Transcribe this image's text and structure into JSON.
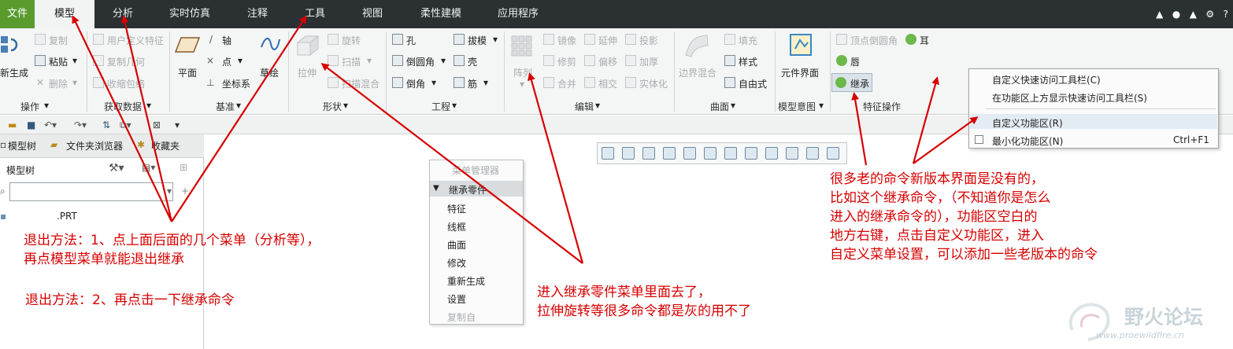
{
  "tabs": [
    {
      "label": "文件"
    },
    {
      "label": "模型"
    },
    {
      "label": "分析"
    },
    {
      "label": "实时仿真"
    },
    {
      "label": "注释"
    },
    {
      "label": "工具"
    },
    {
      "label": "视图"
    },
    {
      "label": "柔性建模"
    },
    {
      "label": "应用程序"
    }
  ],
  "ribbon": {
    "operations": {
      "regen_label": "新生成",
      "copy": "复制",
      "paste": "粘贴",
      "delete": "删除",
      "group_label": "操作"
    },
    "get_data": {
      "udf": "用户定义特征",
      "copy_geom": "复制几何",
      "shrinkwrap": "收缩包络",
      "group_label": "获取数据"
    },
    "datum": {
      "plane": "平面",
      "axis": "轴",
      "point": "点",
      "csys": "坐标系",
      "sketch": "草绘",
      "group_label": "基准"
    },
    "shapes": {
      "extrude": "拉伸",
      "revolve": "旋转",
      "sweep": "扫描",
      "swept_blend": "扫描混合",
      "group_label": "形状"
    },
    "engineering": {
      "hole": "孔",
      "round": "倒圆角",
      "chamfer": "倒角",
      "draft": "拔模",
      "shell": "壳",
      "rib": "筋",
      "group_label": "工程"
    },
    "editing": {
      "pattern": "阵列",
      "mirror": "镜像",
      "trim": "修剪",
      "merge": "合并",
      "extend": "延伸",
      "offset": "偏移",
      "intersect": "相交",
      "project": "投影",
      "thicken": "加厚",
      "solidify": "实体化",
      "group_label": "编辑"
    },
    "surfaces": {
      "boundary_blend": "边界混合",
      "fill": "填充",
      "style": "样式",
      "freestyle": "自由式",
      "group_label": "曲面"
    },
    "model_intent": {
      "component_interface": "元件界面",
      "group_label": "模型意图"
    },
    "feature_ops": {
      "vertex_round": "顶点倒圆角",
      "ear": "耳",
      "lip": "唇",
      "inheritance": "继承",
      "group_label": "特征操作"
    }
  },
  "left_panel": {
    "tab_model_tree": "模型树",
    "tab_folder_browser": "文件夹浏览器",
    "tab_favorites": "收藏夹",
    "tree_label": "模型树",
    "filter_value": "",
    "tree_item": ".PRT"
  },
  "menu_manager": {
    "title": "菜单管理器",
    "section": "继承零件",
    "items": [
      "特征",
      "线框",
      "曲面",
      "修改",
      "重新生成",
      "设置",
      "复制自"
    ]
  },
  "context_menu": {
    "items": [
      {
        "label": "自定义快速访问工具栏(C)"
      },
      {
        "label": "在功能区上方显示快速访问工具栏(S)"
      },
      {
        "label": "自定义功能区(R)"
      },
      {
        "label": "最小化功能区(N)",
        "shortcut": "Ctrl+F1"
      }
    ]
  },
  "annotations": {
    "exit_method_1_line1": "退出方法：1、点上面后面的几个菜单（分析等），",
    "exit_method_1_line2": "再点模型菜单就能退出继承",
    "exit_method_2": "退出方法：2、再点击一下继承命令",
    "menu_note_line1": "进入继承零件菜单里面去了，",
    "menu_note_line2": "拉伸旋转等很多命令都是灰的用不了",
    "right_note": [
      "很多老的命令新版本界面是没有的，",
      "比如这个继承命令，（不知道你是怎么",
      "进入的继承命令的），功能区空白的",
      "地方右键，点击自定义功能区，进入",
      "自定义菜单设置，可以添加一些老版本的命令"
    ]
  },
  "watermark": {
    "name": "野火论坛",
    "url": "www.proewildfire.cn"
  },
  "colors": {
    "tabbar": "#2b3033",
    "file_tab": "#5a9b2e",
    "annotation": "#d60000",
    "ribbon": "#f4f5f5"
  }
}
